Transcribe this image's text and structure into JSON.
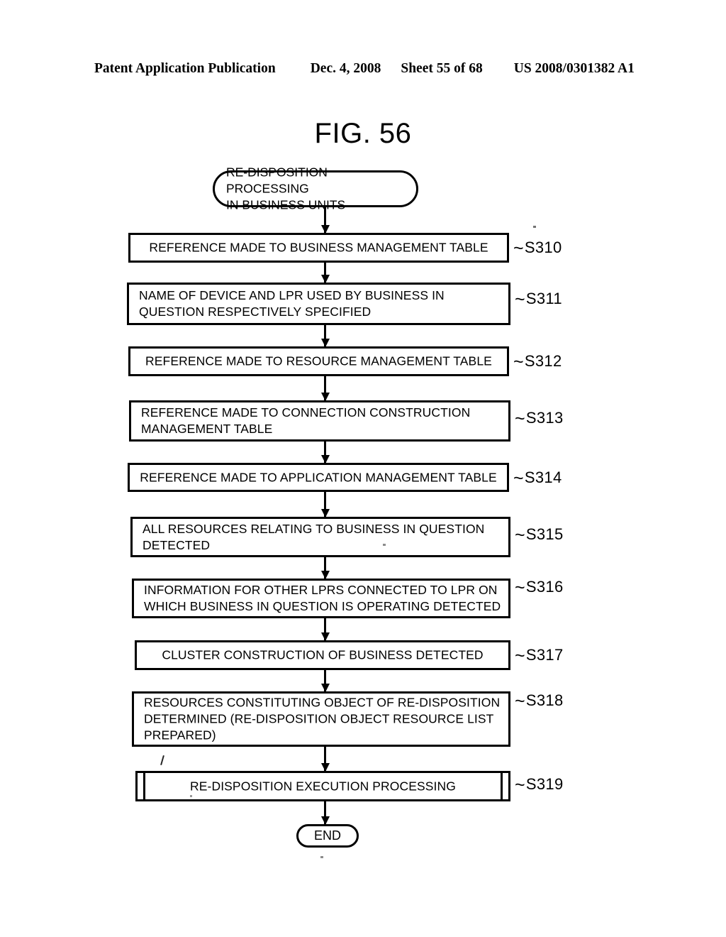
{
  "header": {
    "publication": "Patent Application Publication",
    "date": "Dec. 4, 2008",
    "sheet": "Sheet 55 of 68",
    "patent_number": "US 2008/0301382 A1"
  },
  "figure": {
    "title": "FIG. 56"
  },
  "flowchart": {
    "start": {
      "text": "RE-DISPOSITION PROCESSING\nIN BUSINESS UNITS",
      "shape": "terminator"
    },
    "end": {
      "text": "END",
      "shape": "terminator"
    },
    "steps": [
      {
        "id": "S310",
        "label": "S310",
        "text": "REFERENCE MADE TO BUSINESS MANAGEMENT TABLE",
        "shape": "process",
        "align": "center"
      },
      {
        "id": "S311",
        "label": "S311",
        "text": "NAME OF DEVICE AND LPR USED BY BUSINESS IN\nQUESTION RESPECTIVELY SPECIFIED",
        "shape": "process",
        "align": "left"
      },
      {
        "id": "S312",
        "label": "S312",
        "text": "REFERENCE MADE TO RESOURCE MANAGEMENT TABLE",
        "shape": "process",
        "align": "center"
      },
      {
        "id": "S313",
        "label": "S313",
        "text": "REFERENCE MADE TO CONNECTION CONSTRUCTION\nMANAGEMENT TABLE",
        "shape": "process",
        "align": "left"
      },
      {
        "id": "S314",
        "label": "S314",
        "text": "REFERENCE MADE TO APPLICATION MANAGEMENT TABLE",
        "shape": "process",
        "align": "center"
      },
      {
        "id": "S315",
        "label": "S315",
        "text": "ALL RESOURCES RELATING TO BUSINESS IN QUESTION\nDETECTED",
        "shape": "process",
        "align": "left"
      },
      {
        "id": "S316",
        "label": "S316",
        "text": "INFORMATION FOR OTHER LPRS CONNECTED TO LPR ON\nWHICH BUSINESS IN QUESTION IS OPERATING DETECTED",
        "shape": "process",
        "align": "left"
      },
      {
        "id": "S317",
        "label": "S317",
        "text": "CLUSTER CONSTRUCTION OF BUSINESS DETECTED",
        "shape": "process",
        "align": "center"
      },
      {
        "id": "S318",
        "label": "S318",
        "text": "RESOURCES CONSTITUTING OBJECT OF RE-DISPOSITION\nDETERMINED (RE-DISPOSITION OBJECT RESOURCE LIST\nPREPARED)",
        "shape": "process",
        "align": "left"
      },
      {
        "id": "S319",
        "label": "S319",
        "text": "RE-DISPOSITION EXECUTION PROCESSING",
        "shape": "predefined-process",
        "align": "center"
      }
    ]
  }
}
